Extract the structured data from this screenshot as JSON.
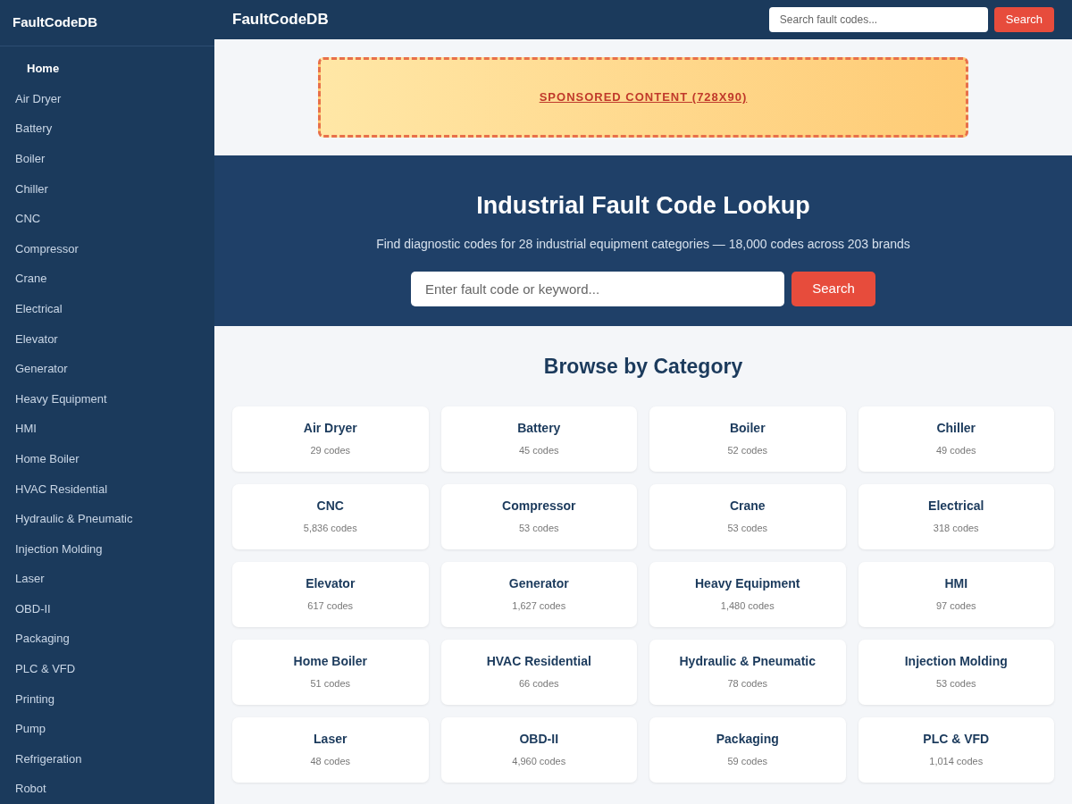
{
  "sidebar": {
    "title": "FaultCodeDB",
    "items": [
      {
        "label": "Home",
        "selected": true
      },
      {
        "label": "Air Dryer",
        "selected": false
      },
      {
        "label": "Battery",
        "selected": false
      },
      {
        "label": "Boiler",
        "selected": false
      },
      {
        "label": "Chiller",
        "selected": false
      },
      {
        "label": "CNC",
        "selected": false
      },
      {
        "label": "Compressor",
        "selected": false
      },
      {
        "label": "Crane",
        "selected": false
      },
      {
        "label": "Electrical",
        "selected": false
      },
      {
        "label": "Elevator",
        "selected": false
      },
      {
        "label": "Generator",
        "selected": false
      },
      {
        "label": "Heavy Equipment",
        "selected": false
      },
      {
        "label": "HMI",
        "selected": false
      },
      {
        "label": "Home Boiler",
        "selected": false
      },
      {
        "label": "HVAC Residential",
        "selected": false
      },
      {
        "label": "Hydraulic & Pneumatic",
        "selected": false
      },
      {
        "label": "Injection Molding",
        "selected": false
      },
      {
        "label": "Laser",
        "selected": false
      },
      {
        "label": "OBD-II",
        "selected": false
      },
      {
        "label": "Packaging",
        "selected": false
      },
      {
        "label": "PLC & VFD",
        "selected": false
      },
      {
        "label": "Printing",
        "selected": false
      },
      {
        "label": "Pump",
        "selected": false
      },
      {
        "label": "Refrigeration",
        "selected": false
      },
      {
        "label": "Robot",
        "selected": false
      }
    ]
  },
  "header": {
    "title": "FaultCodeDB",
    "search": {
      "placeholder": "Search fault codes..."
    },
    "button": "Search"
  },
  "banner": {
    "label": "SPONSORED CONTENT (728X90)"
  },
  "hero": {
    "title": "Industrial Fault Code Lookup",
    "subtitle": "Find diagnostic codes for 28 industrial equipment categories — 18,000 codes across 203 brands",
    "search": {
      "placeholder": "Enter fault code or keyword..."
    },
    "button": "Search"
  },
  "categories": {
    "title": "Browse by Category",
    "cards": [
      {
        "name": "Air Dryer",
        "count": "29 codes"
      },
      {
        "name": "Battery",
        "count": "45 codes"
      },
      {
        "name": "Boiler",
        "count": "52 codes"
      },
      {
        "name": "Chiller",
        "count": "49 codes"
      },
      {
        "name": "CNC",
        "count": "5,836 codes"
      },
      {
        "name": "Compressor",
        "count": "53 codes"
      },
      {
        "name": "Crane",
        "count": "53 codes"
      },
      {
        "name": "Electrical",
        "count": "318 codes"
      },
      {
        "name": "Elevator",
        "count": "617 codes"
      },
      {
        "name": "Generator",
        "count": "1,627 codes"
      },
      {
        "name": "Heavy Equipment",
        "count": "1,480 codes"
      },
      {
        "name": "HMI",
        "count": "97 codes"
      },
      {
        "name": "Home Boiler",
        "count": "51 codes"
      },
      {
        "name": "HVAC Residential",
        "count": "66 codes"
      },
      {
        "name": "Hydraulic & Pneumatic",
        "count": "78 codes"
      },
      {
        "name": "Injection Molding",
        "count": "53 codes"
      },
      {
        "name": "Laser",
        "count": "48 codes"
      },
      {
        "name": "OBD-II",
        "count": "4,960 codes"
      },
      {
        "name": "Packaging",
        "count": "59 codes"
      },
      {
        "name": "PLC & VFD",
        "count": "1,014 codes"
      }
    ]
  }
}
